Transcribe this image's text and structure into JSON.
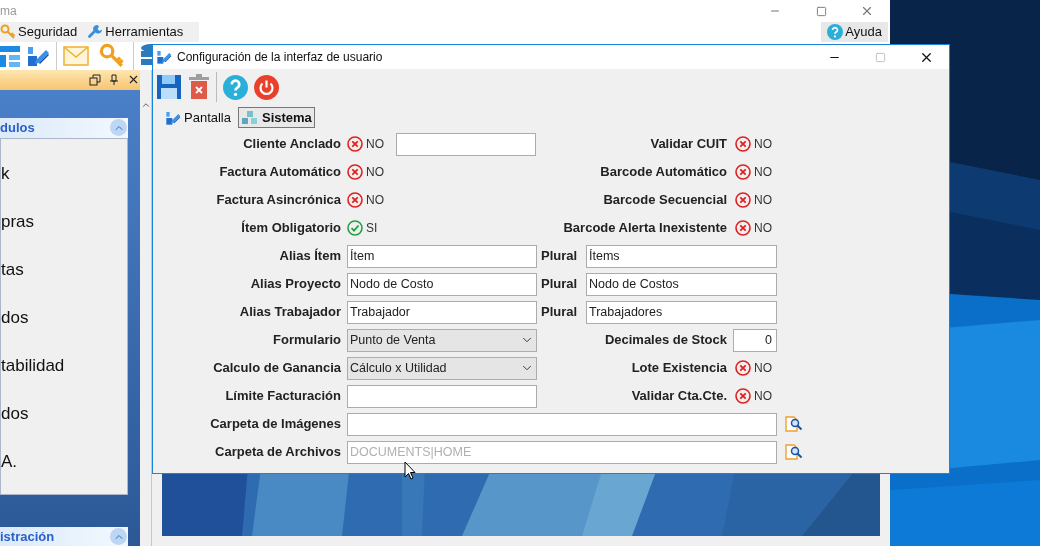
{
  "main_window": {
    "title": "ma",
    "menu": [
      {
        "label": "Seguridad",
        "kind": "key"
      },
      {
        "label": "Herramientas",
        "kind": "wrench"
      }
    ],
    "help_menu": "Ayuda",
    "panel": {
      "section": "dulos",
      "items": [
        "k",
        "pras",
        "tas",
        "dos",
        "tabilidad",
        "dos",
        "A."
      ],
      "next_section": "istración"
    }
  },
  "dialog": {
    "title": "Configuración de la interfaz de usuario",
    "tabs": [
      {
        "label": "Pantalla",
        "selected": false
      },
      {
        "label": "Sistema",
        "selected": true
      }
    ],
    "rows": [
      {
        "left": {
          "kind": "toggle_text",
          "label": "Cliente Anclado",
          "on": false,
          "text": "NO"
        },
        "right": {
          "kind": "toggle",
          "label": "Validar CUIT",
          "on": false,
          "text": "NO"
        }
      },
      {
        "left": {
          "kind": "toggle",
          "label": "Factura Automático",
          "on": false,
          "text": "NO"
        },
        "right": {
          "kind": "toggle",
          "label": "Barcode Automático",
          "on": false,
          "text": "NO"
        }
      },
      {
        "left": {
          "kind": "toggle",
          "label": "Factura Asincrónica",
          "on": false,
          "text": "NO"
        },
        "right": {
          "kind": "toggle",
          "label": "Barcode Secuencial",
          "on": false,
          "text": "NO"
        }
      },
      {
        "left": {
          "kind": "toggle",
          "label": "Ítem Obligatorio",
          "on": true,
          "text": "SI"
        },
        "right": {
          "kind": "toggle",
          "label": "Barcode Alerta Inexistente",
          "on": false,
          "text": "NO"
        }
      },
      {
        "left": {
          "kind": "text",
          "label": "Alias Ítem",
          "value": "Ítem"
        },
        "right": {
          "kind": "text",
          "label": "Plural",
          "value": "Ítems"
        }
      },
      {
        "left": {
          "kind": "text",
          "label": "Alias Proyecto",
          "value": "Nodo de Costo"
        },
        "right": {
          "kind": "text",
          "label": "Plural",
          "value": "Nodo de Costos"
        }
      },
      {
        "left": {
          "kind": "text",
          "label": "Alias Trabajador",
          "value": "Trabajador"
        },
        "right": {
          "kind": "text",
          "label": "Plural",
          "value": "Trabajadores"
        }
      },
      {
        "left": {
          "kind": "select",
          "label": "Formulario",
          "value": "Punto de Venta"
        },
        "right": {
          "kind": "number",
          "label": "Decimales de Stock",
          "value": "0"
        }
      },
      {
        "left": {
          "kind": "select",
          "label": "Calculo de Ganancia",
          "value": "Cálculo x Utilidad"
        },
        "right": {
          "kind": "toggle",
          "label": "Lote Existencia",
          "on": false,
          "text": "NO"
        }
      },
      {
        "left": {
          "kind": "text",
          "label": "Límite Facturación"
        },
        "right": {
          "kind": "toggle",
          "label": "Validar Cta.Cte.",
          "on": false,
          "text": "NO"
        }
      },
      {
        "left": {
          "kind": "path",
          "label": "Carpeta de Imágenes"
        }
      },
      {
        "left": {
          "kind": "path",
          "label": "Carpeta de Archivos",
          "placeholder": "DOCUMENTS|HOME"
        }
      }
    ]
  }
}
